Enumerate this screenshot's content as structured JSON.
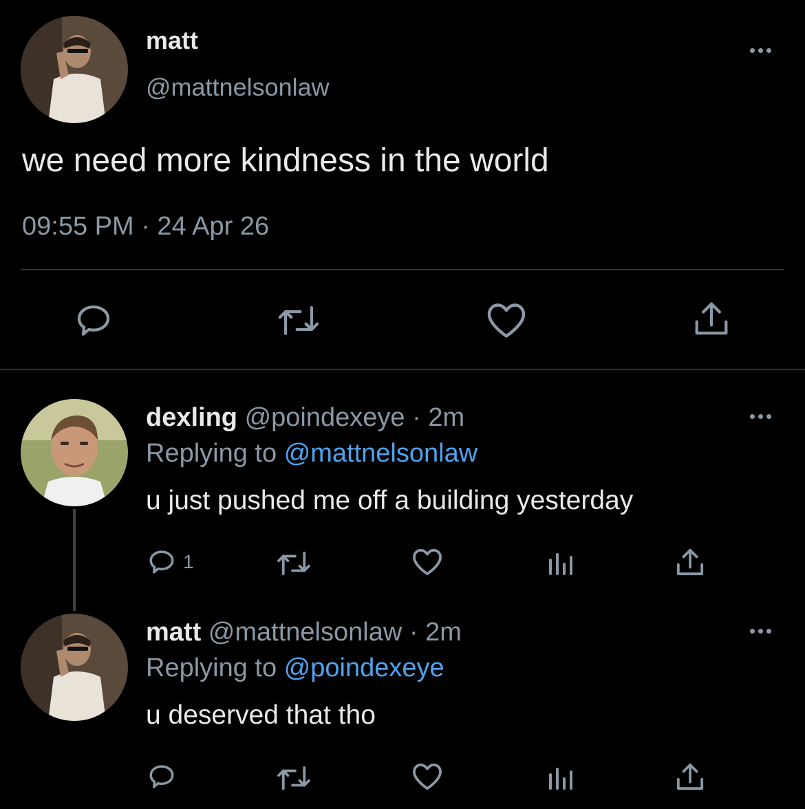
{
  "main_tweet": {
    "display_name": "matt",
    "handle": "@mattnelsonlaw",
    "text": "we need more kindness in the world",
    "timestamp": "09:55 PM · 24 Apr 26"
  },
  "replies": [
    {
      "display_name": "dexling",
      "handle": "@poindexeye",
      "separator": "·",
      "age": "2m",
      "replying_prefix": "Replying to",
      "replying_to": "@mattnelsonlaw",
      "text": "u just pushed me off a building yesterday",
      "reply_count": "1"
    },
    {
      "display_name": "matt",
      "handle": "@mattnelsonlaw",
      "separator": "·",
      "age": "2m",
      "replying_prefix": "Replying to",
      "replying_to": "@poindexeye",
      "text": "u deserved that tho",
      "reply_count": ""
    }
  ],
  "icons": [
    "reply-icon",
    "retweet-icon",
    "like-icon",
    "share-icon",
    "analytics-icon",
    "more-icon"
  ],
  "colors": {
    "background": "#000000",
    "text": "#e7e9ea",
    "muted": "#8b98a5",
    "link": "#4ea3ee",
    "divider": "#2f3336"
  }
}
